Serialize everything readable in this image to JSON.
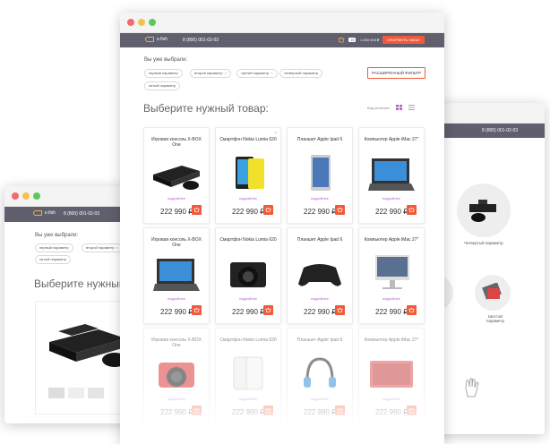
{
  "brand": "e.fish",
  "phone": "8 (800) 001-02-03",
  "cart": {
    "count": "15",
    "total": "1 200 000 ₽",
    "order_label": "ОФОРМИТЬ ЗАКАЗ"
  },
  "filters": {
    "title": "Вы уже выбрали:",
    "chips": [
      "первый параметр",
      "второй параметр",
      "третий параметр",
      "четвертый параметр",
      "пятый параметр"
    ],
    "extended_label": "РАСШИРЕННЫЙ ФИЛЬТР"
  },
  "catalog": {
    "title": "Выберите нужный товар:",
    "view_label": "Вид каталога",
    "more_label": "подробнее",
    "products": [
      {
        "name": "Игровая консоль X-BOX One",
        "price": "222 990 ₽",
        "icon": "xbox-console"
      },
      {
        "name": "Смартфон Nokia Lumia 620",
        "price": "222 990 ₽",
        "icon": "nokia-phone"
      },
      {
        "name": "Планшет Apple Ipad 6",
        "price": "222 990 ₽",
        "icon": "ipad"
      },
      {
        "name": "Компьютер Apple iMac 27\"",
        "price": "222 990 ₽",
        "icon": "surface-tablet"
      },
      {
        "name": "Игровая консоль X-BOX One",
        "price": "222 990 ₽",
        "icon": "surface-tablet"
      },
      {
        "name": "Смартфон Nokia Lumia 620",
        "price": "222 990 ₽",
        "icon": "dslr-camera"
      },
      {
        "name": "Планшет Apple Ipad 6",
        "price": "222 990 ₽",
        "icon": "gamepad"
      },
      {
        "name": "Компьютер Apple iMac 27\"",
        "price": "222 990 ₽",
        "icon": "imac"
      },
      {
        "name": "Игровая консоль X-BOX One",
        "price": "222 990 ₽",
        "icon": "red-camera"
      },
      {
        "name": "Смартфон Nokia Lumia 620",
        "price": "222 990 ₽",
        "icon": "galaxy-phone"
      },
      {
        "name": "Планшет Apple Ipad 6",
        "price": "222 990 ₽",
        "icon": "headphones"
      },
      {
        "name": "Компьютер Apple iMac 27\"",
        "price": "222 990 ₽",
        "icon": "red-tablet"
      }
    ]
  },
  "left_window": {
    "phone": "8 (800) 001-02-03",
    "title": "Вы уже выбрали:",
    "chips": [
      "первый параметр",
      "второй параметр",
      "третий параметр",
      "пятый параметр"
    ],
    "heading": "Выберите нужный то"
  },
  "right_window": {
    "phone": "8 (800) 001-02-03",
    "caption_1": "Четвертый параметр",
    "caption_2": "Шестой параметр"
  },
  "colors": {
    "topbar": "#5f5f6e",
    "accent": "#f05a3a",
    "more_link": "#b05bd1"
  }
}
